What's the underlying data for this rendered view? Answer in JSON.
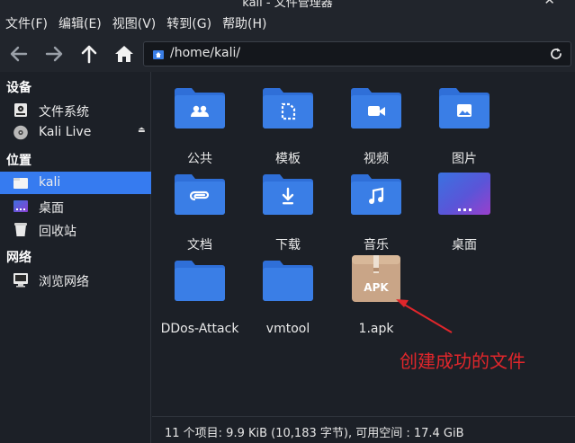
{
  "window": {
    "title": "kali - 文件管理器",
    "close_glyph": "✕"
  },
  "menu": [
    "文件(F)",
    "编辑(E)",
    "视图(V)",
    "转到(G)",
    "帮助(H)"
  ],
  "location": {
    "path": "/home/kali/"
  },
  "sidebar": {
    "sections": [
      {
        "title": "设备",
        "items": [
          {
            "label": "文件系统",
            "icon": "drive-icon"
          },
          {
            "label": "Kali Live",
            "icon": "disc-icon",
            "eject": "⏏"
          }
        ]
      },
      {
        "title": "位置",
        "items": [
          {
            "label": "kali",
            "icon": "home-folder-icon",
            "selected": true
          },
          {
            "label": "桌面",
            "icon": "desktop-icon"
          },
          {
            "label": "回收站",
            "icon": "trash-icon"
          }
        ]
      },
      {
        "title": "网络",
        "items": [
          {
            "label": "浏览网络",
            "icon": "network-icon"
          }
        ]
      }
    ]
  },
  "files": [
    {
      "label": "公共",
      "icon": "folder-public-icon"
    },
    {
      "label": "模板",
      "icon": "folder-templates-icon"
    },
    {
      "label": "视频",
      "icon": "folder-videos-icon"
    },
    {
      "label": "图片",
      "icon": "folder-pictures-icon"
    },
    {
      "label": "文档",
      "icon": "folder-documents-icon"
    },
    {
      "label": "下载",
      "icon": "folder-downloads-icon"
    },
    {
      "label": "音乐",
      "icon": "folder-music-icon"
    },
    {
      "label": "桌面",
      "icon": "desktop-folder-icon"
    },
    {
      "label": "DDos-Attack",
      "icon": "folder-icon"
    },
    {
      "label": "vmtool",
      "icon": "folder-icon"
    },
    {
      "label": "1.apk",
      "icon": "apk-package-icon",
      "badge": "APK"
    }
  ],
  "annotation": {
    "text": "创建成功的文件"
  },
  "status": {
    "text": "11 个项目: 9.9 KiB (10,183 字节), 可用空间 : 17.4 GiB"
  },
  "colors": {
    "accent": "#367bf0",
    "folder": "#3a7ee6",
    "annotation": "#e0262b",
    "apk_box": "#c9a587"
  }
}
